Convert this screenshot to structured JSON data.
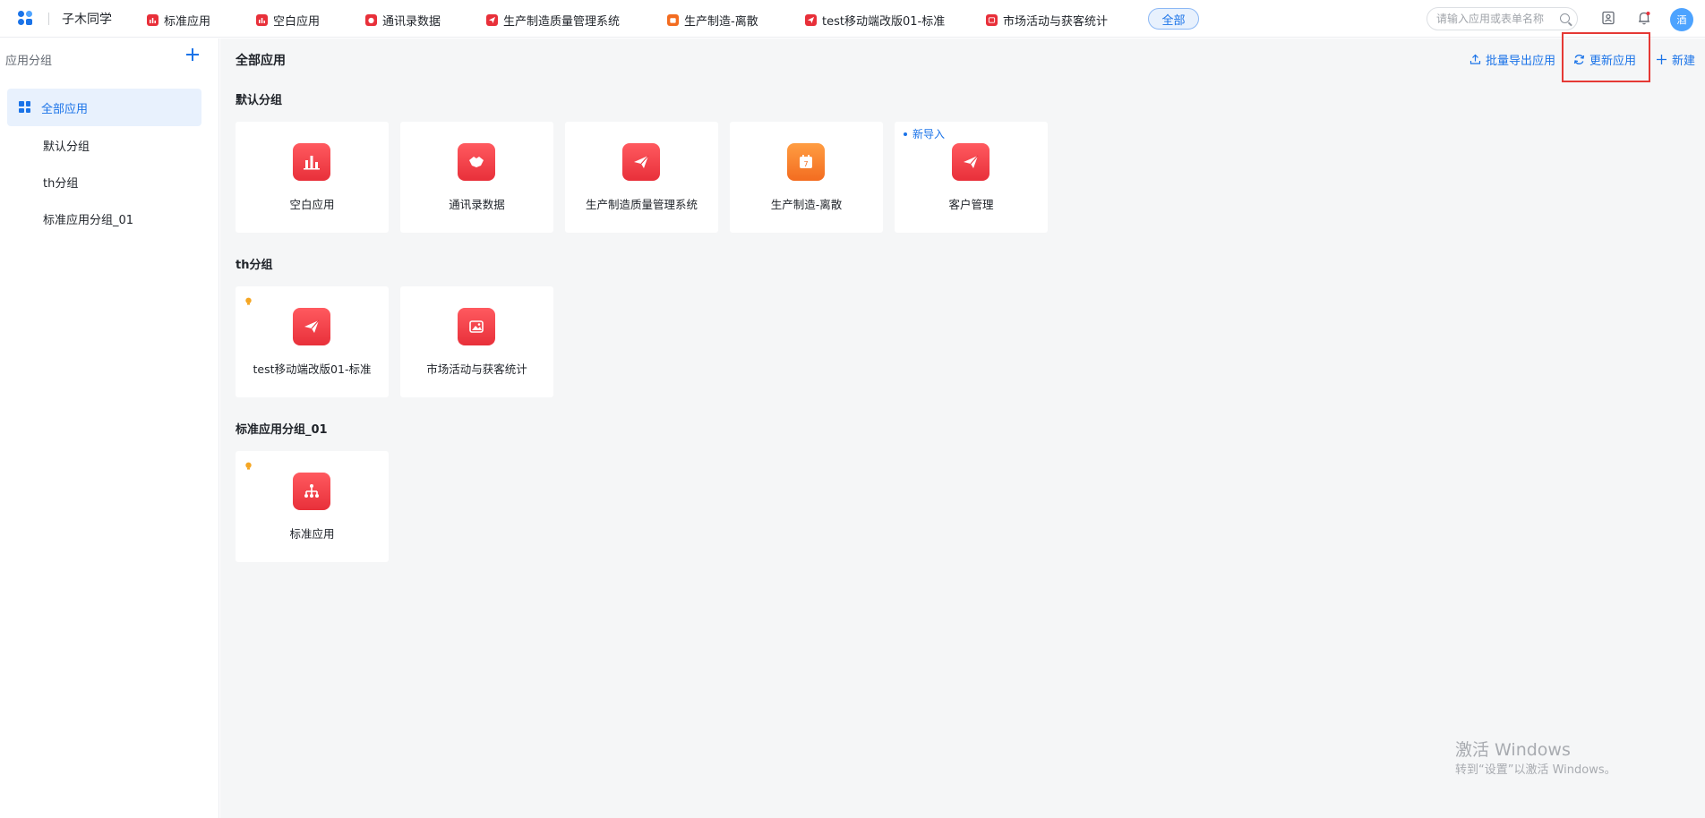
{
  "topbar": {
    "brand": "子木同学",
    "tabs": [
      {
        "label": "标准应用",
        "icon": "chart-icon",
        "color": "#e8303a"
      },
      {
        "label": "空白应用",
        "icon": "chart-icon",
        "color": "#e8303a"
      },
      {
        "label": "通讯录数据",
        "icon": "handshake-icon",
        "color": "#e8303a"
      },
      {
        "label": "生产制造质量管理系统",
        "icon": "paper-plane-icon",
        "color": "#e8303a"
      },
      {
        "label": "生产制造-离散",
        "icon": "calendar-icon",
        "color": "#f36c20"
      },
      {
        "label": "test移动端改版01-标准",
        "icon": "paper-plane-icon",
        "color": "#e8303a"
      },
      {
        "label": "市场活动与获客统计",
        "icon": "image-icon",
        "color": "#e8303a"
      }
    ],
    "all_label": "全部",
    "search_placeholder": "请输入应用或表单名称",
    "avatar_text": "酒"
  },
  "sidebar": {
    "header": "应用分组",
    "items": [
      {
        "label": "全部应用",
        "active": true
      },
      {
        "label": "默认分组",
        "active": false
      },
      {
        "label": "th分组",
        "active": false
      },
      {
        "label": "标准应用分组_01",
        "active": false
      }
    ]
  },
  "main": {
    "title": "全部应用",
    "actions": {
      "export": "批量导出应用",
      "update": "更新应用",
      "create": "新建"
    },
    "groups": [
      {
        "title": "默认分组",
        "apps": [
          {
            "name": "空白应用",
            "icon": "chart-icon",
            "color": "red"
          },
          {
            "name": "通讯录数据",
            "icon": "handshake-icon",
            "color": "red"
          },
          {
            "name": "生产制造质量管理系统",
            "icon": "paper-plane-icon",
            "color": "red"
          },
          {
            "name": "生产制造-离散",
            "icon": "calendar-icon",
            "color": "orange"
          },
          {
            "name": "客户管理",
            "icon": "paper-plane-icon",
            "color": "red",
            "tag": "新导入"
          }
        ]
      },
      {
        "title": "th分组",
        "apps": [
          {
            "name": "test移动端改版01-标准",
            "icon": "paper-plane-icon",
            "color": "red"
          },
          {
            "name": "市场活动与获客统计",
            "icon": "image-icon",
            "color": "red"
          }
        ]
      },
      {
        "title": "标准应用分组_01",
        "apps": [
          {
            "name": "标准应用",
            "icon": "org-tree-icon",
            "color": "red"
          }
        ]
      }
    ]
  },
  "watermark": {
    "line1": "激活 Windows",
    "line2": "转到“设置”以激活 Windows。"
  }
}
